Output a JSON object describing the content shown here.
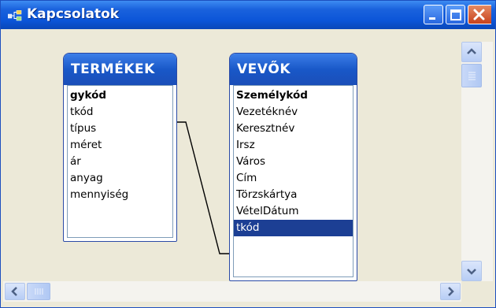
{
  "window": {
    "title": "Kapcsolatok"
  },
  "icons": {
    "app": "relationships-icon",
    "minimize": "minimize-icon",
    "maximize": "maximize-icon",
    "close": "close-icon",
    "scroll_up": "arrow-up-icon",
    "scroll_down": "arrow-down-icon",
    "scroll_left": "arrow-left-icon",
    "scroll_right": "arrow-right-icon"
  },
  "tables": [
    {
      "name": "TERMÉKEK",
      "fields": [
        {
          "label": "gykód",
          "key": true
        },
        {
          "label": "tkód"
        },
        {
          "label": "típus"
        },
        {
          "label": "méret"
        },
        {
          "label": "ár"
        },
        {
          "label": "anyag"
        },
        {
          "label": "mennyiség"
        }
      ]
    },
    {
      "name": "VEVŐK",
      "fields": [
        {
          "label": "Személykód",
          "key": true
        },
        {
          "label": "Vezetéknév"
        },
        {
          "label": "Keresztnév"
        },
        {
          "label": "Irsz"
        },
        {
          "label": "Város"
        },
        {
          "label": "Cím"
        },
        {
          "label": "Törzskártya"
        },
        {
          "label": "VételDátum"
        },
        {
          "label": "tkód",
          "selected": true
        }
      ]
    }
  ],
  "relationship": {
    "from": "TERMÉKEK.tkód",
    "to": "VEVŐK.tkód"
  },
  "colors": {
    "title_bar": "#0b55d8",
    "table_header": "#1958c8",
    "selected_row": "#1c3f94",
    "canvas_bg": "#ece9d8"
  }
}
